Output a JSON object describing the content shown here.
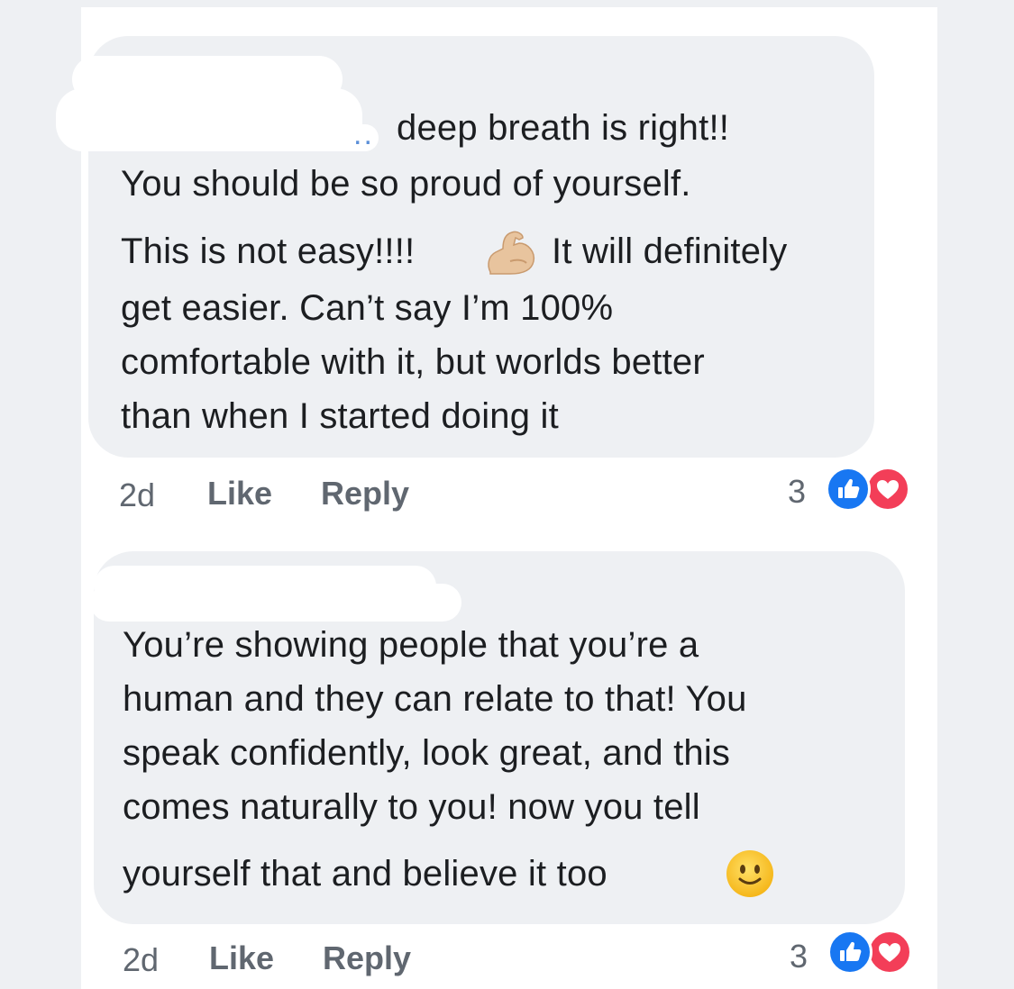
{
  "comments": [
    {
      "lines": [
        "deep breath is right!!",
        "You should be so proud of yourself.",
        "This is not easy!!!!",
        "It will definitely",
        "get easier. Can’t say I’m 100%",
        "comfortable with it, but worlds better",
        "than when I started doing it"
      ],
      "mention_dots": "..",
      "time": "2d",
      "like_label": "Like",
      "reply_label": "Reply",
      "reaction_count": "3",
      "reactions": [
        "like-icon",
        "love-icon"
      ],
      "inline_emoji": "flexed-biceps-icon"
    },
    {
      "lines": [
        "You’re showing people that you’re a",
        "human and they can relate to that! You",
        "speak confidently, look great, and this",
        "comes naturally to you! now you tell",
        "yourself that and believe it too"
      ],
      "time": "2d",
      "like_label": "Like",
      "reply_label": "Reply",
      "reaction_count": "3",
      "reactions": [
        "like-icon",
        "love-icon"
      ],
      "inline_emoji": "slightly-smiling-face-icon"
    }
  ],
  "colors": {
    "bubble": "#eef0f3",
    "text": "#1c1e21",
    "meta": "#606770",
    "like": "#1877f2",
    "love": "#f33e58"
  }
}
